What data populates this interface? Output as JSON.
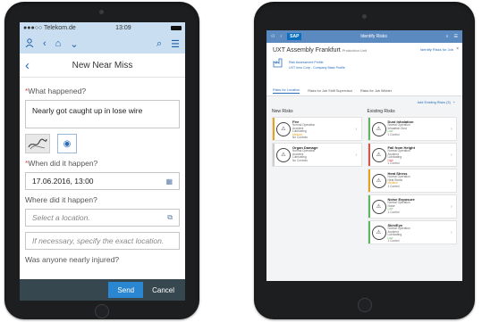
{
  "left": {
    "status": {
      "carrier": "●●●○○ Telekom.de",
      "time": "13:09"
    },
    "nav_title": "New Near Miss",
    "form": {
      "what_label": "What happened?",
      "what_value": "Nearly got caught up in lose wire",
      "when_label": "When did it happen?",
      "when_value": "17.06.2016, 13:00",
      "where_label": "Where did it happen?",
      "location_placeholder": "Select a location.",
      "exact_placeholder": "If necessary, specify the exact location.",
      "injured_label": "Was anyone nearly injured?"
    },
    "footer": {
      "send": "Send",
      "cancel": "Cancel"
    }
  },
  "right": {
    "shell": {
      "logo": "SAP",
      "title": "Identify Risks"
    },
    "header": {
      "title": "UXT Assembly Frankfurt",
      "title_sub": "Production Unit",
      "action": "Identify Risks for Job",
      "sub1": "Risk Assessment Profile",
      "sub2": "UXT Inno Corp - Company Base Profile"
    },
    "tabs": [
      "Risks for Location",
      "Risks for Job Shift Supervisor",
      "Risks for Job Welder"
    ],
    "add_existing": "Add Existing Risks (3)",
    "new_risks": {
      "heading": "New Risks",
      "items": [
        {
          "name": "Fire",
          "lines": [
            "Normal Operation",
            "Accident",
            "Lubricating"
          ],
          "level": "Medium",
          "status": "No Controls",
          "color": "#e8a21a"
        },
        {
          "name": "Organ Damage",
          "lines": [
            "Normal Operation",
            "Accident",
            "Lubricating"
          ],
          "level": "",
          "status": "No Controls",
          "color": "#cccccc"
        }
      ]
    },
    "existing_risks": {
      "heading": "Existing Risks",
      "items": [
        {
          "name": "Dust Inhalation",
          "lines": [
            "Normal Operation",
            "Inhalation Dust"
          ],
          "level": "Low",
          "status": "1 Control",
          "color": "#5cb85c"
        },
        {
          "name": "Fall from Height",
          "lines": [
            "Normal Operation",
            "Accident",
            "Lubricating"
          ],
          "level": "High",
          "status": "1 Control",
          "color": "#d9534f"
        },
        {
          "name": "Heat Stress",
          "lines": [
            "Normal Operation",
            "Heat Stress"
          ],
          "level": "Medium",
          "status": "1 Control",
          "color": "#e8a21a"
        },
        {
          "name": "Noise Exposure",
          "lines": [
            "Normal Operation",
            "Noise"
          ],
          "level": "Low",
          "status": "1 Control",
          "color": "#5cb85c"
        },
        {
          "name": "Skin/Eye",
          "lines": [
            "Normal Operation",
            "Accident",
            "Lubricating"
          ],
          "level": "Low",
          "status": "1 Control",
          "color": "#5cb85c"
        }
      ]
    }
  }
}
